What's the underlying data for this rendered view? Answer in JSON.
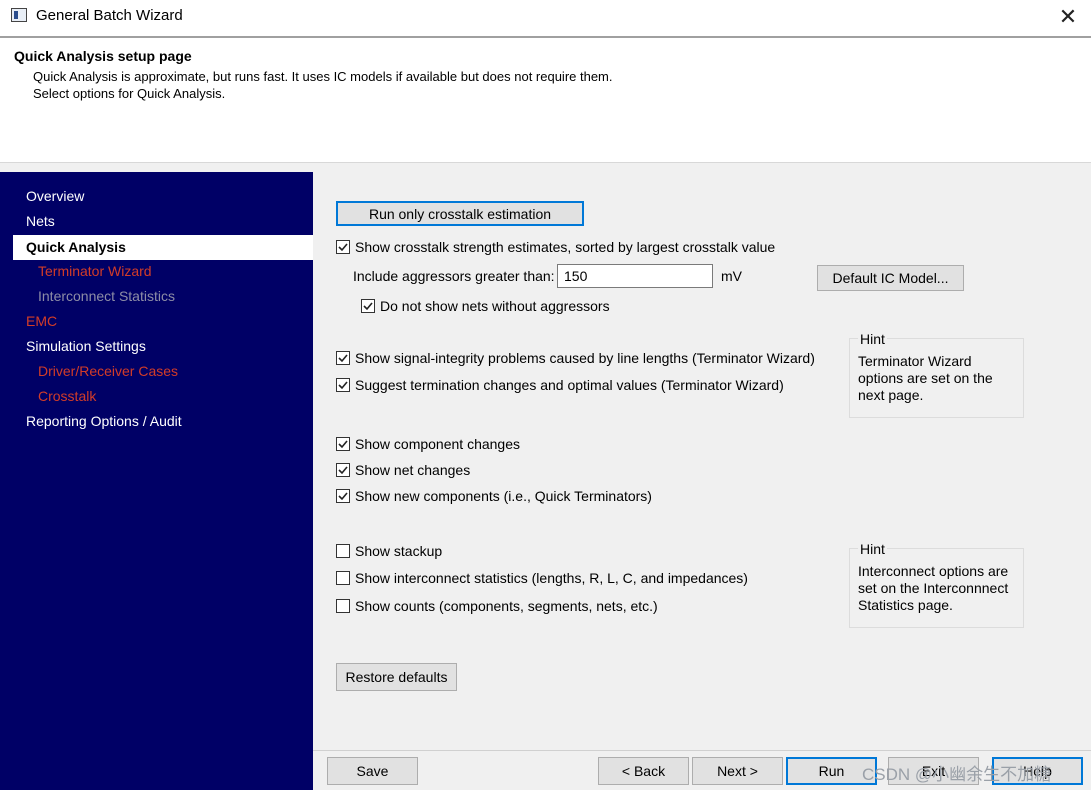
{
  "window": {
    "title": "General Batch Wizard"
  },
  "header": {
    "title": "Quick Analysis setup page",
    "desc1": "Quick Analysis is approximate, but runs fast. It uses IC models if available but does not require them.",
    "desc2": "Select options for Quick Analysis."
  },
  "sidebar": {
    "items": [
      {
        "label": "Overview",
        "style": "normal"
      },
      {
        "label": "Nets",
        "style": "normal"
      },
      {
        "label": "Quick Analysis",
        "style": "active"
      },
      {
        "label": "Terminator Wizard",
        "style": "red-sub"
      },
      {
        "label": "Interconnect Statistics",
        "style": "gray-sub"
      },
      {
        "label": "EMC",
        "style": "red"
      },
      {
        "label": "Simulation Settings",
        "style": "normal"
      },
      {
        "label": "Driver/Receiver Cases",
        "style": "red-sub"
      },
      {
        "label": "Crosstalk",
        "style": "red-sub"
      },
      {
        "label": "Reporting Options / Audit",
        "style": "normal"
      }
    ]
  },
  "content": {
    "run_crosstalk_button": "Run only crosstalk estimation",
    "opt_crosstalk": {
      "label": "Show crosstalk strength estimates, sorted by largest crosstalk value",
      "checked": true
    },
    "aggressor_label": "Include aggressors greater than:",
    "aggressor_value": "150",
    "aggressor_unit": "mV",
    "default_ic_button": "Default IC Model...",
    "opt_no_aggressors": {
      "label": "Do not show nets without aggressors",
      "checked": true
    },
    "opt_si_problems": {
      "label": "Show signal-integrity problems caused by line lengths (Terminator Wizard)",
      "checked": true
    },
    "opt_termination": {
      "label": "Suggest termination changes and optimal values (Terminator Wizard)",
      "checked": true
    },
    "hint1": {
      "title": "Hint",
      "line1": "Terminator Wizard",
      "line2": "options are set on the",
      "line3": "next page."
    },
    "opt_component_changes": {
      "label": "Show component changes",
      "checked": true
    },
    "opt_net_changes": {
      "label": "Show net changes",
      "checked": true
    },
    "opt_new_components": {
      "label": "Show new components  (i.e., Quick Terminators)",
      "checked": true
    },
    "opt_stackup": {
      "label": "Show stackup",
      "checked": false
    },
    "opt_interconnect": {
      "label": "Show interconnect statistics (lengths, R, L, C, and impedances)",
      "checked": false
    },
    "opt_counts": {
      "label": "Show counts (components, segments, nets, etc.)",
      "checked": false
    },
    "hint2": {
      "title": "Hint",
      "line1": "Interconnect options are",
      "line2": "set on the Interconnnect",
      "line3": "Statistics page."
    },
    "restore_button": "Restore defaults"
  },
  "footer": {
    "save": "Save",
    "back": "< Back",
    "next": "Next >",
    "run": "Run",
    "exit": "Exit",
    "help": "Help"
  },
  "watermark": "CSDN @小幽余生不加糖"
}
